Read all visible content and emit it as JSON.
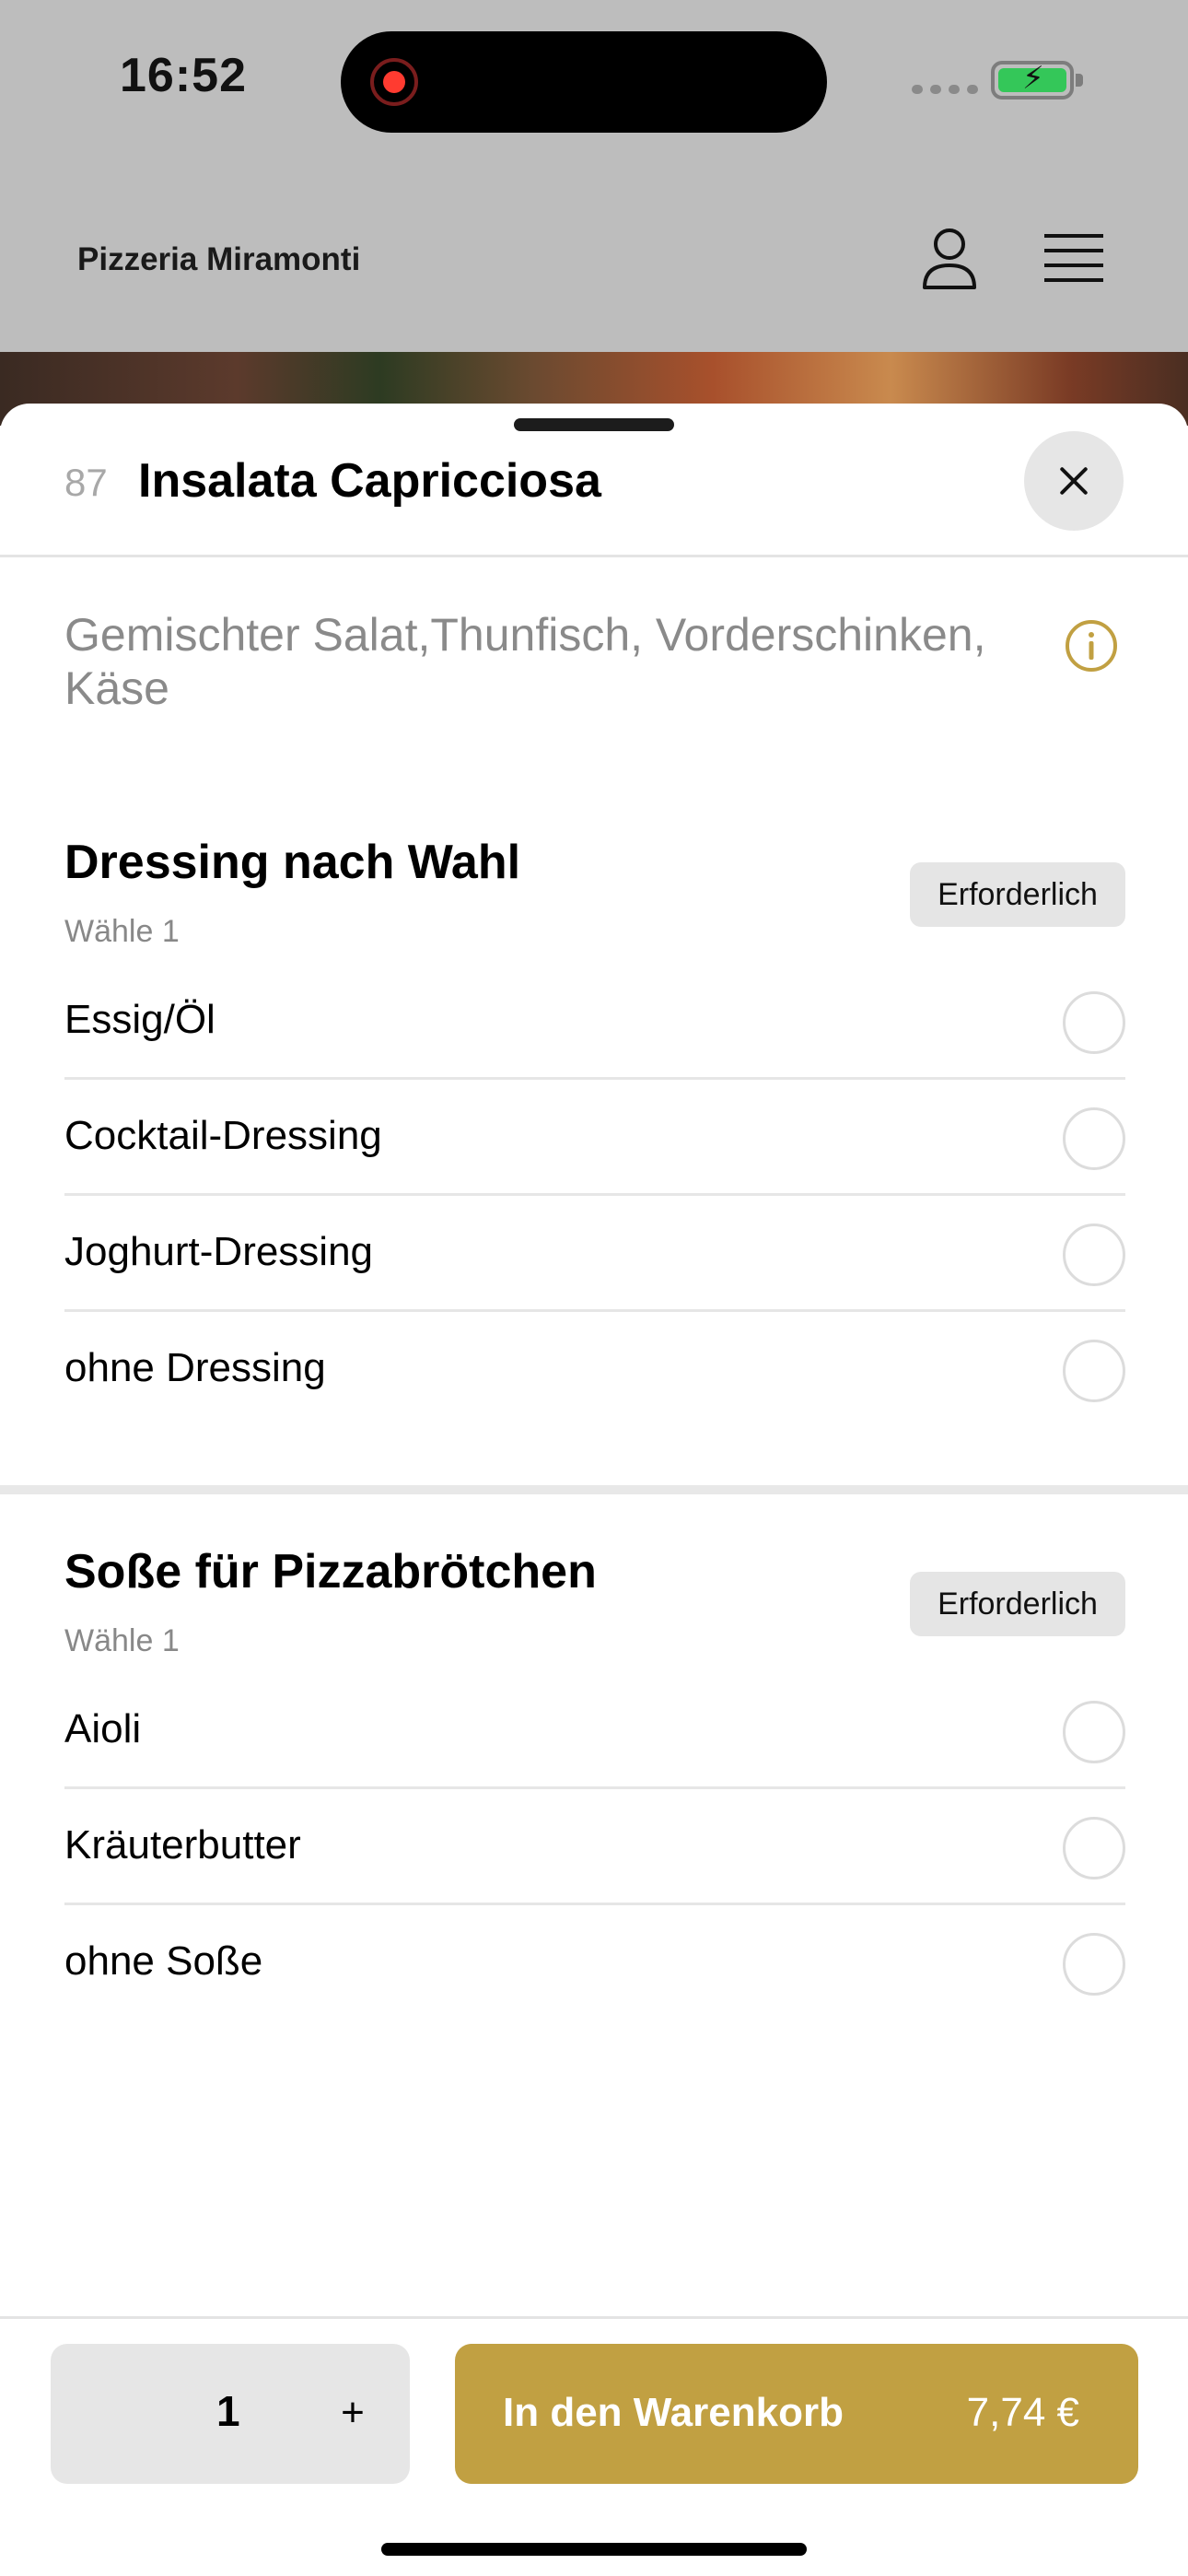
{
  "status_bar": {
    "time": "16:52"
  },
  "header": {
    "restaurant_name": "Pizzeria Miramonti",
    "profile_icon": "person-icon",
    "menu_icon": "hamburger-menu-icon"
  },
  "item": {
    "number": "87",
    "title": "Insalata Capricciosa",
    "description": "Gemischter Salat,Thunfisch, Vorderschinken, Käse"
  },
  "option_groups": [
    {
      "title": "Dressing nach Wahl",
      "subtitle": "Wähle 1",
      "badge": "Erforderlich",
      "options": [
        {
          "label": "Essig/Öl",
          "selected": false
        },
        {
          "label": "Cocktail-Dressing",
          "selected": false
        },
        {
          "label": "Joghurt-Dressing",
          "selected": false
        },
        {
          "label": "ohne Dressing",
          "selected": false
        }
      ]
    },
    {
      "title": "Soße für Pizzabrötchen",
      "subtitle": "Wähle 1",
      "badge": "Erforderlich",
      "options": [
        {
          "label": "Aioli",
          "selected": false
        },
        {
          "label": "Kräuterbutter",
          "selected": false
        },
        {
          "label": "ohne Soße",
          "selected": false
        }
      ]
    }
  ],
  "footer": {
    "quantity": "1",
    "plus_label": "+",
    "cart_label": "In den Warenkorb",
    "price": "7,74 €"
  },
  "colors": {
    "accent": "#c1a042",
    "overlay": "#bdbdbd",
    "battery": "#34c759"
  }
}
